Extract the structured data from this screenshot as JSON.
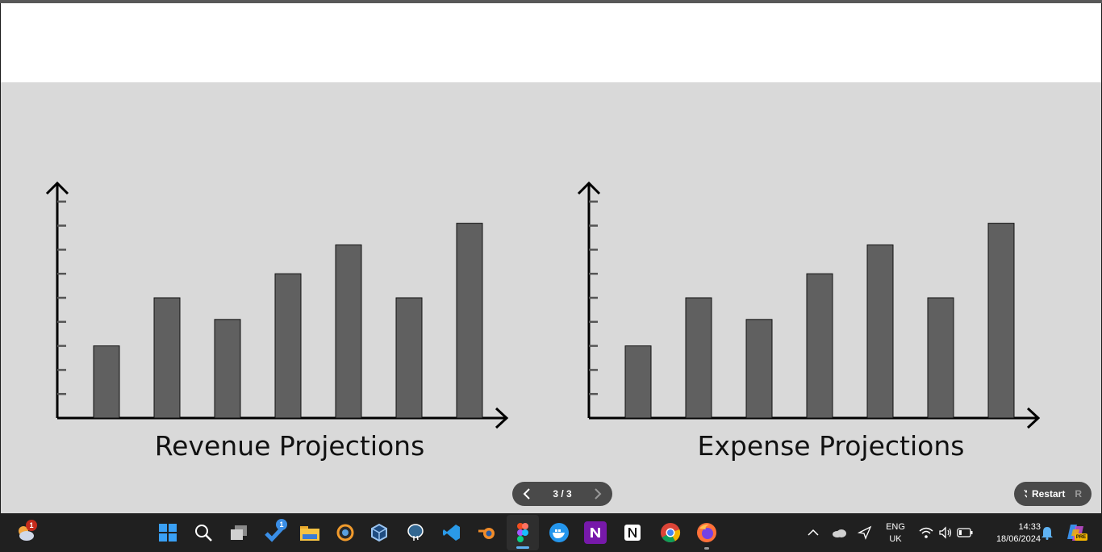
{
  "charts": [
    {
      "title": "Revenue Projections"
    },
    {
      "title": "Expense Projections"
    }
  ],
  "chart_data": [
    {
      "type": "bar",
      "title": "Revenue Projections",
      "values": [
        3,
        5,
        4.1,
        6,
        7.2,
        5,
        8.1
      ],
      "ylim": [
        0,
        9
      ],
      "grid": false
    },
    {
      "type": "bar",
      "title": "Expense Projections",
      "values": [
        3,
        5,
        4.1,
        6,
        7.2,
        5,
        8.1
      ],
      "ylim": [
        0,
        9
      ],
      "grid": false
    }
  ],
  "controls": {
    "pager_text": "3 / 3",
    "restart_label": "Restart",
    "restart_shortcut": "R"
  },
  "taskbar": {
    "weather_badge": "1",
    "todo_badge": "1",
    "lang_line1": "ENG",
    "lang_line2": "UK",
    "time": "14:33",
    "date": "18/06/2024",
    "copilot_tag": "PRE"
  },
  "colors": {
    "stage_bg": "#d9d9d9",
    "bar_fill": "#606060",
    "control_bg": "#4a4a4a",
    "taskbar_bg": "#202020",
    "accent": "#5fb2f2"
  }
}
